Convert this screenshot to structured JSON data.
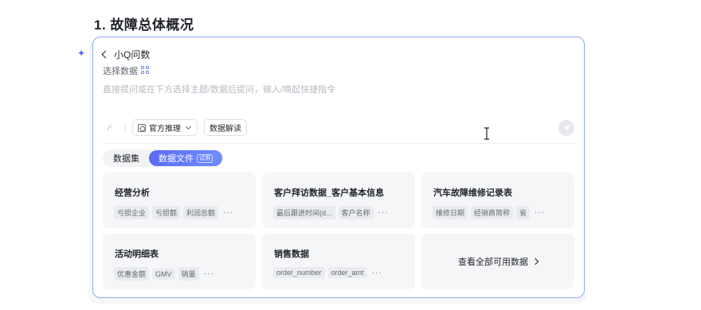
{
  "page": {
    "heading": "1. 故障总体概况"
  },
  "assistant": {
    "back_label": "小Q问数",
    "select_data_label": "选择数据",
    "input_placeholder": "直接提问或在下方选择主题/数据后提问，输入/唤起快捷指令"
  },
  "toolbar": {
    "recommend_label": "官方推理",
    "interpret_label": "数据解读"
  },
  "tabs": [
    {
      "label": "数据集",
      "active": false
    },
    {
      "label": "数据文件",
      "active": true,
      "badge": "试用"
    }
  ],
  "cards": [
    {
      "title": "经营分析",
      "tags": [
        "亏损企业",
        "亏损额",
        "利润总额"
      ],
      "more": "···"
    },
    {
      "title": "客户拜访数据_客户基本信息",
      "tags": [
        "最后跟进时间(d...",
        "客户名称"
      ],
      "more": "···"
    },
    {
      "title": "汽车故障维修记录表",
      "tags": [
        "维修日期",
        "经销商简称",
        "省"
      ],
      "more": "···"
    },
    {
      "title": "活动明细表",
      "tags": [
        "优惠金额",
        "GMV",
        "销量"
      ],
      "more": "···"
    },
    {
      "title": "销售数据",
      "tags": [
        "order_number",
        "order_amt"
      ],
      "more": "···"
    }
  ],
  "view_all_label": "查看全部可用数据",
  "colors": {
    "accent": "#5b6cf6",
    "border": "#8fa6f5"
  },
  "icons": [
    "sparkle-icon",
    "chevron-left-icon",
    "data-select-icon",
    "recommend-icon",
    "chevron-down-icon",
    "send-icon",
    "chevron-right-icon",
    "text-cursor-icon"
  ]
}
